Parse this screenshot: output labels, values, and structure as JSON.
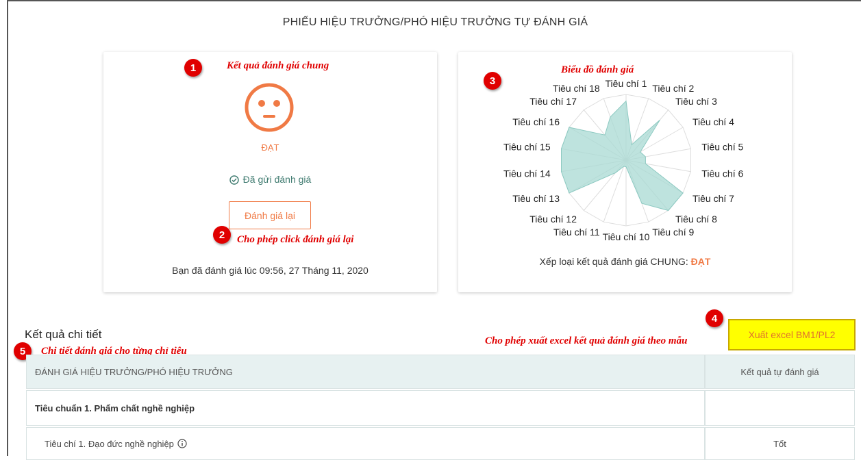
{
  "page": {
    "title": "PHIẾU HIỆU TRƯỞNG/PHÓ HIỆU TRƯỞNG TỰ ĐÁNH GIÁ"
  },
  "result_card": {
    "status": "ĐẠT",
    "sent_label": "Đã gửi đánh giá",
    "reevaluate_label": "Đánh giá lại",
    "timestamp": "Bạn đã đánh giá lúc 09:56, 27 Tháng 11, 2020"
  },
  "chart_card": {
    "classification_label": "Xếp loại kết quả đánh giá CHUNG:",
    "classification_value": "ĐẠT"
  },
  "chart_data": {
    "type": "radar",
    "categories": [
      "Tiêu chí 1",
      "Tiêu chí 2",
      "Tiêu chí 3",
      "Tiêu chí 4",
      "Tiêu chí 5",
      "Tiêu chí 6",
      "Tiêu chí 7",
      "Tiêu chí 8",
      "Tiêu chí 9",
      "Tiêu chí 10",
      "Tiêu chí 11",
      "Tiêu chí 12",
      "Tiêu chí 13",
      "Tiêu chí 14",
      "Tiêu chí 15",
      "Tiêu chí 16",
      "Tiêu chí 17",
      "Tiêu chí 18"
    ],
    "values": [
      0.9,
      0.25,
      0.8,
      0.25,
      0.3,
      0.3,
      1.0,
      1.0,
      0.7,
      0.1,
      0.1,
      0.25,
      1.0,
      1.0,
      1.0,
      1.0,
      0.5,
      0.7
    ],
    "ylim": [
      0,
      1
    ],
    "grid": true,
    "fill_color": "#a8dad3"
  },
  "annotations": {
    "a1": {
      "number": "1",
      "text": "Kết quả đánh giá chung"
    },
    "a2": {
      "number": "2",
      "text": "Cho phép click đánh giá lại"
    },
    "a3": {
      "number": "3",
      "text": "Biểu đồ đánh giá"
    },
    "a4": {
      "number": "4",
      "text": "Cho phép xuất excel kết quả đánh giá theo mẫu"
    },
    "a5": {
      "number": "5",
      "text": "Chi tiết đánh giá cho từng chỉ tiêu"
    }
  },
  "export_button": {
    "label": "Xuất excel BM1/PL2"
  },
  "detail": {
    "title": "Kết quả chi tiết",
    "columns": [
      "ĐÁNH GIÁ HIỆU TRƯỞNG/PHÓ HIỆU TRƯỞNG",
      "Kết quả tự đánh giá"
    ],
    "standard_1": {
      "label": "Tiêu chuẩn 1. Phẩm chất nghề nghiệp",
      "result": ""
    },
    "criterion_1": {
      "label": "Tiêu chí 1. Đạo đức nghề nghiệp",
      "result": "Tốt"
    }
  },
  "colors": {
    "accent": "#f07a45",
    "teal": "#3e7a6f",
    "annotation": "#e00000",
    "export_bg": "#ffff00"
  },
  "icons": {
    "face": "neutral-face-icon",
    "check": "check-circle-icon",
    "info": "info-icon"
  }
}
